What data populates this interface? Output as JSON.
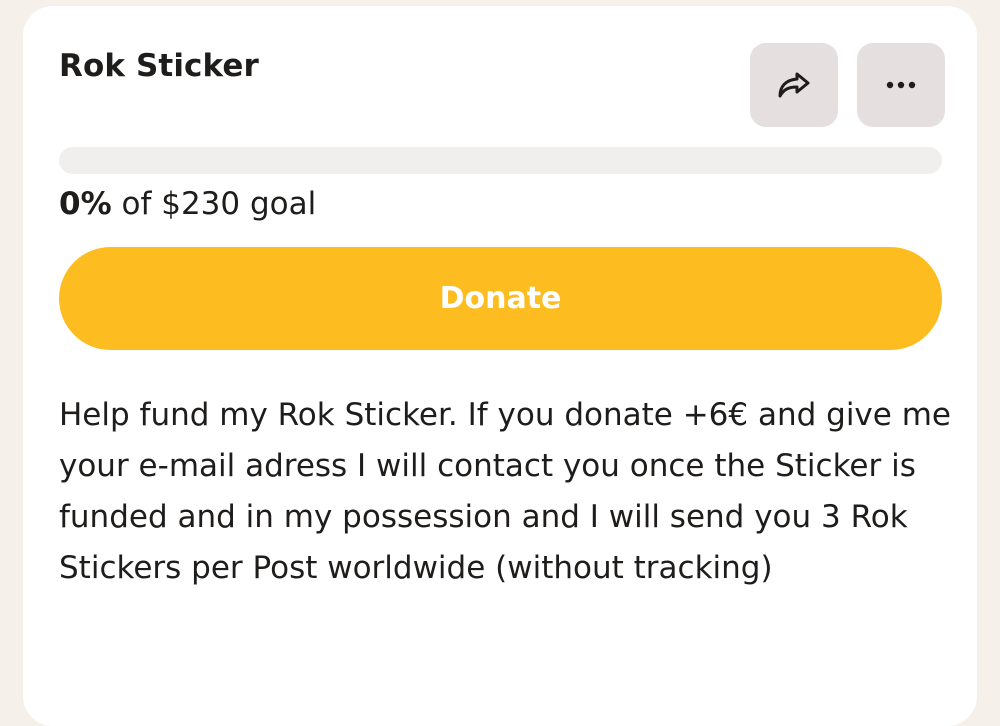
{
  "fundraiser": {
    "title": "Rok Sticker",
    "progress_fraction": 0,
    "progress_percent": "0%",
    "goal_text": " of $230 goal",
    "donate_label": "Donate",
    "description": "Help fund my Rok Sticker. If you donate +6€ and give me your e-mail adress I will contact you once the Sticker is funded and in my possession and I will send you 3 Rok Stickers per Post worldwide (without tracking)"
  },
  "actions": {
    "share_icon": "share-arrow-icon",
    "more_icon": "more-horizontal-icon"
  },
  "colors": {
    "accent": "#fdbd20",
    "icon_button_bg": "#e6dfdf",
    "progress_track": "#f0efee",
    "page_bg": "#f5f1ea"
  }
}
